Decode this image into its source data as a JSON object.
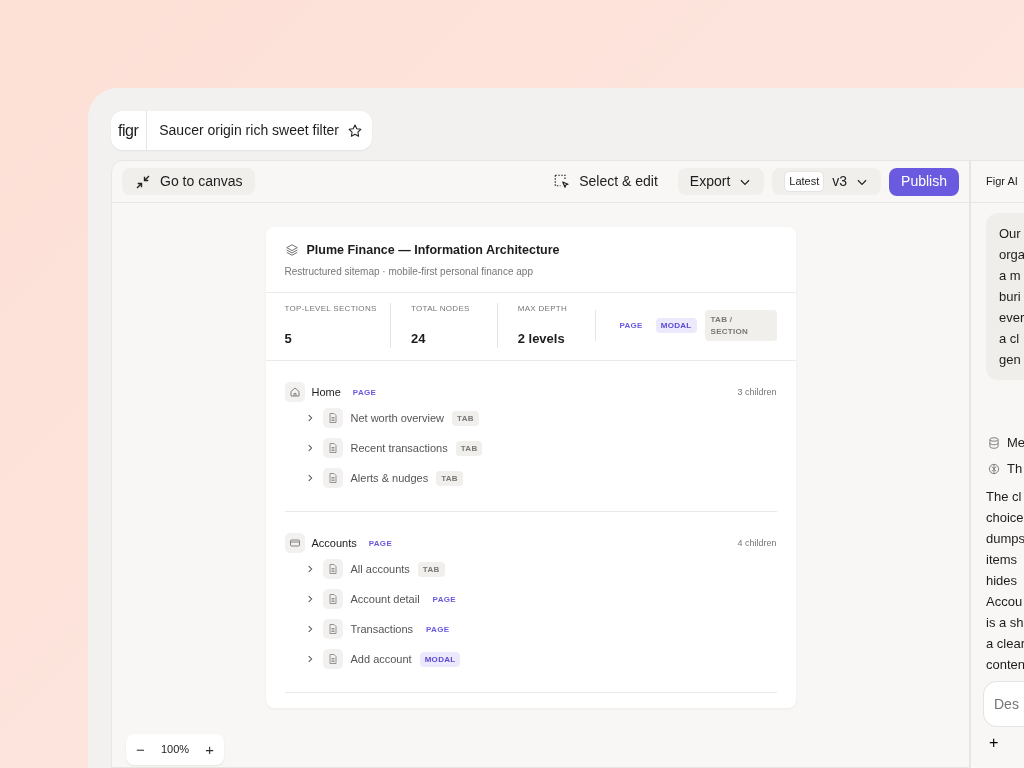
{
  "header": {
    "logo": "figr",
    "title": "Saucer origin rich sweet filter",
    "starred": false
  },
  "toolbar": {
    "back": "Go to canvas",
    "select": "Select & edit",
    "export": "Export",
    "version": {
      "tag": "Latest",
      "label": "v3"
    },
    "publish": "Publish"
  },
  "document": {
    "title": "Plume Finance — Information Architecture",
    "subtitle": "Restructured sitemap · mobile-first personal finance app",
    "stats": [
      {
        "label": "TOP-LEVEL SECTIONS",
        "value": "5"
      },
      {
        "label": "TOTAL NODES",
        "value": "24"
      },
      {
        "label": "MAX DEPTH",
        "value": "2 levels"
      }
    ],
    "legend": [
      {
        "label": "PAGE",
        "kind": "page"
      },
      {
        "label": "MODAL",
        "kind": "modal"
      },
      {
        "label": "TAB / SECTION",
        "kind": "tab"
      }
    ],
    "sections": [
      {
        "name": "Home",
        "badge": {
          "label": "PAGE",
          "kind": "page"
        },
        "count": "3 children",
        "children": [
          {
            "name": "Net worth overview",
            "badge": {
              "label": "TAB",
              "kind": "tab"
            }
          },
          {
            "name": "Recent transactions",
            "badge": {
              "label": "TAB",
              "kind": "tab"
            }
          },
          {
            "name": "Alerts & nudges",
            "badge": {
              "label": "TAB",
              "kind": "tab"
            }
          }
        ]
      },
      {
        "name": "Accounts",
        "badge": {
          "label": "PAGE",
          "kind": "page"
        },
        "count": "4 children",
        "children": [
          {
            "name": "All accounts",
            "badge": {
              "label": "TAB",
              "kind": "tab"
            }
          },
          {
            "name": "Account detail",
            "badge": {
              "label": "PAGE",
              "kind": "page"
            }
          },
          {
            "name": "Transactions",
            "badge": {
              "label": "PAGE",
              "kind": "page"
            }
          },
          {
            "name": "Add account",
            "badge": {
              "label": "MODAL",
              "kind": "modal"
            }
          }
        ]
      }
    ]
  },
  "zoom": {
    "minus": "−",
    "value": "100%",
    "plus": "+"
  },
  "assistant": {
    "title": "Figr AI",
    "message": [
      "Our",
      "orga",
      "a m",
      "buri",
      "ever",
      "a cl",
      "gen"
    ],
    "steps": [
      {
        "label": "Me"
      },
      {
        "label": "Th"
      }
    ],
    "reply": [
      "The cl",
      "choice",
      "dumps",
      "items",
      "hides",
      "Accou",
      "is a sh",
      "a clear",
      "conten"
    ],
    "input": {
      "placeholder": "Des"
    },
    "add": "+"
  }
}
